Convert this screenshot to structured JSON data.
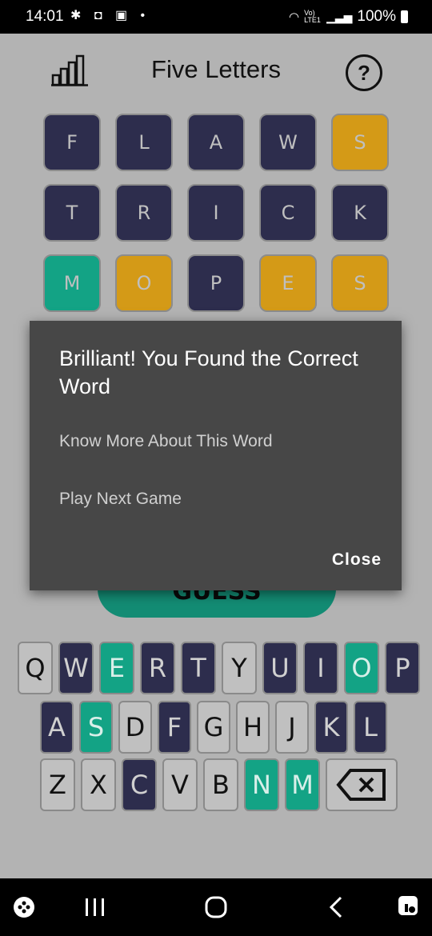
{
  "status": {
    "time": "14:01",
    "battery": "100%",
    "net": "Vo) LTE1"
  },
  "header": {
    "title": "Five Letters"
  },
  "grid": [
    [
      {
        "l": "F",
        "s": "absent"
      },
      {
        "l": "L",
        "s": "absent"
      },
      {
        "l": "A",
        "s": "absent"
      },
      {
        "l": "W",
        "s": "absent"
      },
      {
        "l": "S",
        "s": "present"
      }
    ],
    [
      {
        "l": "T",
        "s": "absent"
      },
      {
        "l": "R",
        "s": "absent"
      },
      {
        "l": "I",
        "s": "absent"
      },
      {
        "l": "C",
        "s": "absent"
      },
      {
        "l": "K",
        "s": "absent"
      }
    ],
    [
      {
        "l": "M",
        "s": "correct"
      },
      {
        "l": "O",
        "s": "present"
      },
      {
        "l": "P",
        "s": "absent"
      },
      {
        "l": "E",
        "s": "present"
      },
      {
        "l": "S",
        "s": "present"
      }
    ]
  ],
  "guess_button": {
    "label": "GUESS"
  },
  "keyboard": {
    "row1": [
      {
        "k": "Q",
        "s": "unused"
      },
      {
        "k": "W",
        "s": "absent"
      },
      {
        "k": "E",
        "s": "correct"
      },
      {
        "k": "R",
        "s": "absent"
      },
      {
        "k": "T",
        "s": "absent"
      },
      {
        "k": "Y",
        "s": "unused"
      },
      {
        "k": "U",
        "s": "absent"
      },
      {
        "k": "I",
        "s": "absent"
      },
      {
        "k": "O",
        "s": "correct"
      },
      {
        "k": "P",
        "s": "absent"
      }
    ],
    "row2": [
      {
        "k": "A",
        "s": "absent"
      },
      {
        "k": "S",
        "s": "correct"
      },
      {
        "k": "D",
        "s": "unused"
      },
      {
        "k": "F",
        "s": "absent"
      },
      {
        "k": "G",
        "s": "unused"
      },
      {
        "k": "H",
        "s": "unused"
      },
      {
        "k": "J",
        "s": "unused"
      },
      {
        "k": "K",
        "s": "absent"
      },
      {
        "k": "L",
        "s": "absent"
      }
    ],
    "row3": [
      {
        "k": "Z",
        "s": "unused"
      },
      {
        "k": "X",
        "s": "unused"
      },
      {
        "k": "C",
        "s": "absent"
      },
      {
        "k": "V",
        "s": "unused"
      },
      {
        "k": "B",
        "s": "unused"
      },
      {
        "k": "N",
        "s": "correct"
      },
      {
        "k": "M",
        "s": "correct"
      }
    ]
  },
  "dialog": {
    "title": "Brilliant! You Found the Correct Word",
    "option_more": "Know More About This Word",
    "option_next": "Play Next Game",
    "close_label": "Close"
  },
  "colors": {
    "absent": "#2d2d4d",
    "present": "#d49a17",
    "correct": "#13a385",
    "dialog": "#474747"
  }
}
